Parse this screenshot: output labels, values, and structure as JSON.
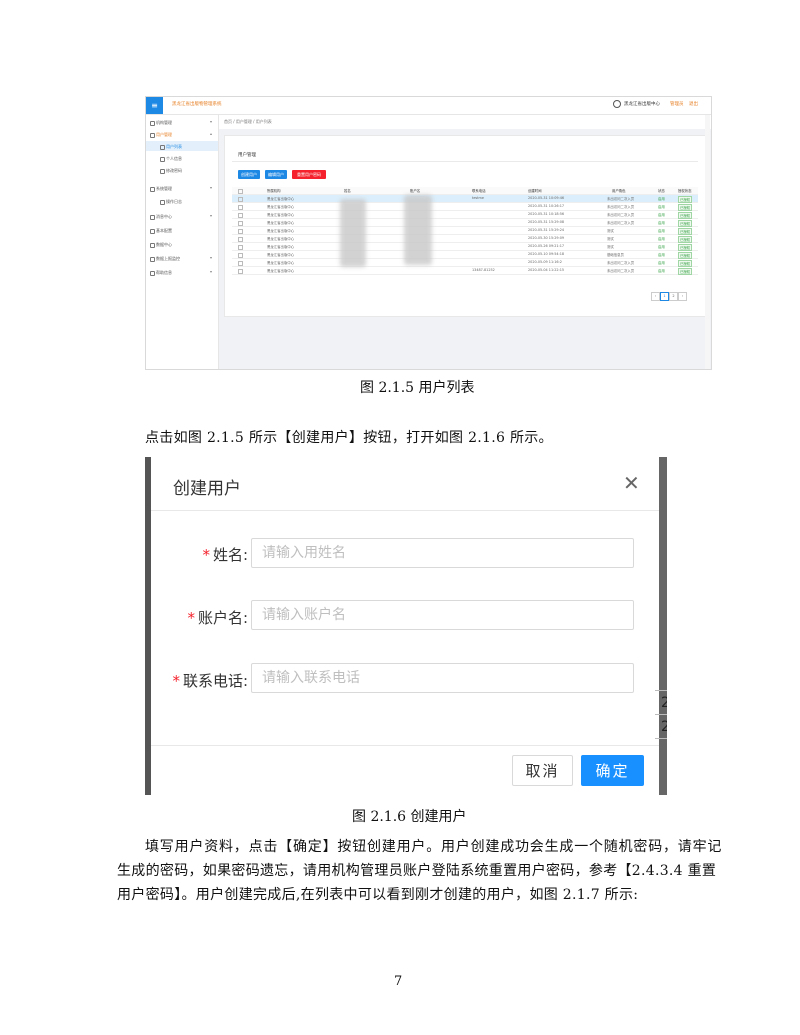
{
  "fig1": {
    "system_title": "黑龙江省出版物管理系统",
    "org_name": "黑龙江省出版中心",
    "user_name": "管理员",
    "logout": "退出",
    "menu_icon": "≡",
    "sidebar": [
      {
        "label": "机构管理",
        "arrow": "▾"
      },
      {
        "label": "用户管理",
        "arrow": "▴"
      },
      {
        "label": "用户列表",
        "arrow": ""
      },
      {
        "label": "个人信息",
        "arrow": ""
      },
      {
        "label": "修改密码",
        "arrow": ""
      },
      {
        "label": "系统管理",
        "arrow": "▾"
      },
      {
        "label": "操作日志",
        "arrow": ""
      },
      {
        "label": "消息中心",
        "arrow": "▾"
      },
      {
        "label": "基本配置",
        "arrow": ""
      },
      {
        "label": "数据中心",
        "arrow": ""
      },
      {
        "label": "数据上报监控",
        "arrow": "▾"
      },
      {
        "label": "帮助信息",
        "arrow": "▾"
      }
    ],
    "breadcrumb": "首页 / 用户管理 / 用户列表",
    "panel_title": "用户管理",
    "buttons": {
      "create": "创建用户",
      "edit": "编辑用户",
      "reset": "重置用户密码"
    },
    "table_headers": [
      "所属机构",
      "姓名",
      "账户名",
      "联系电话",
      "创建时间",
      "用户角色",
      "状态",
      "授权状态"
    ],
    "rows": [
      {
        "org": "黑龙江省出版中心",
        "phone": "testme",
        "time": "2020-05-31 10:09:46",
        "role": "未出访问二次入员",
        "status": "启用",
        "auth": "已授权"
      },
      {
        "org": "黑龙江省出版中心",
        "phone": "",
        "time": "2020-05-31 10:26:17",
        "role": "未出访问二次入员",
        "status": "启用",
        "auth": "已授权"
      },
      {
        "org": "黑龙江省出版中心",
        "phone": "",
        "time": "2020-05-31 10:18:56",
        "role": "未出访问二次入员",
        "status": "启用",
        "auth": "已授权"
      },
      {
        "org": "黑龙江省出版中心",
        "phone": "",
        "time": "2020-05-31 15:29:08",
        "role": "未出访问二次入员",
        "status": "启用",
        "auth": "已授权"
      },
      {
        "org": "黑龙江省出版中心",
        "phone": "",
        "time": "2020-05-31 15:29:24",
        "role": "测试",
        "status": "启用",
        "auth": "已授权"
      },
      {
        "org": "黑龙江省出版中心",
        "phone": "",
        "time": "2020-05-30 15:29:09",
        "role": "测试",
        "status": "启用",
        "auth": "已授权"
      },
      {
        "org": "黑龙江省出版中心",
        "phone": "",
        "time": "2020-05-26 09:21:17",
        "role": "测试",
        "status": "启用",
        "auth": "已授权"
      },
      {
        "org": "黑龙江省出版中心",
        "phone": "",
        "time": "2020-05-10 09:54:18",
        "role": "基础信息员",
        "status": "启用",
        "auth": "已授权"
      },
      {
        "org": "黑龙江省出版中心",
        "phone": "",
        "time": "2020-05-09 11:16:2",
        "role": "未出访问二次入员",
        "status": "启用",
        "auth": "已授权"
      },
      {
        "org": "黑龙江省出版中心",
        "phone": "13487-81252",
        "time": "2020-05-04 11:22:15",
        "role": "未出访问二次入员",
        "status": "启用",
        "auth": "已授权"
      }
    ],
    "pager": [
      "‹",
      "1",
      "2",
      "›"
    ]
  },
  "caption1": "图 2.1.5  用户列表",
  "para1": "点击如图 2.1.5 所示【创建用户】按钮，打开如图 2.1.6 所示。",
  "fig2": {
    "title": "创建用户",
    "close_icon": "✕",
    "required_mark": "*",
    "fields": [
      {
        "label": "姓名:",
        "placeholder": "请输入用姓名"
      },
      {
        "label": "账户名:",
        "placeholder": "请输入账户名"
      },
      {
        "label": "联系电话:",
        "placeholder": "请输入联系电话"
      }
    ],
    "bg_char": "2",
    "cancel": "取消",
    "ok": "确定"
  },
  "caption2": "图 2.1.6  创建用户",
  "para2": [
    "填写用户资料，点击【确定】按钮创建用户。用户创建成功会生成一个随机密码，请牢记",
    "生成的密码，如果密码遗忘，请用机构管理员账户登陆系统重置用户密码，参考【2.4.3.4  重置",
    "用户密码】。用户创建完成后,在列表中可以看到刚才创建的用户，如图 2.1.7 所示:"
  ],
  "page_number": "7",
  "colors": {
    "primary": "#1890ff",
    "danger": "#f5222d",
    "accent_orange": "#e67e22",
    "success": "#2e9e3e"
  }
}
